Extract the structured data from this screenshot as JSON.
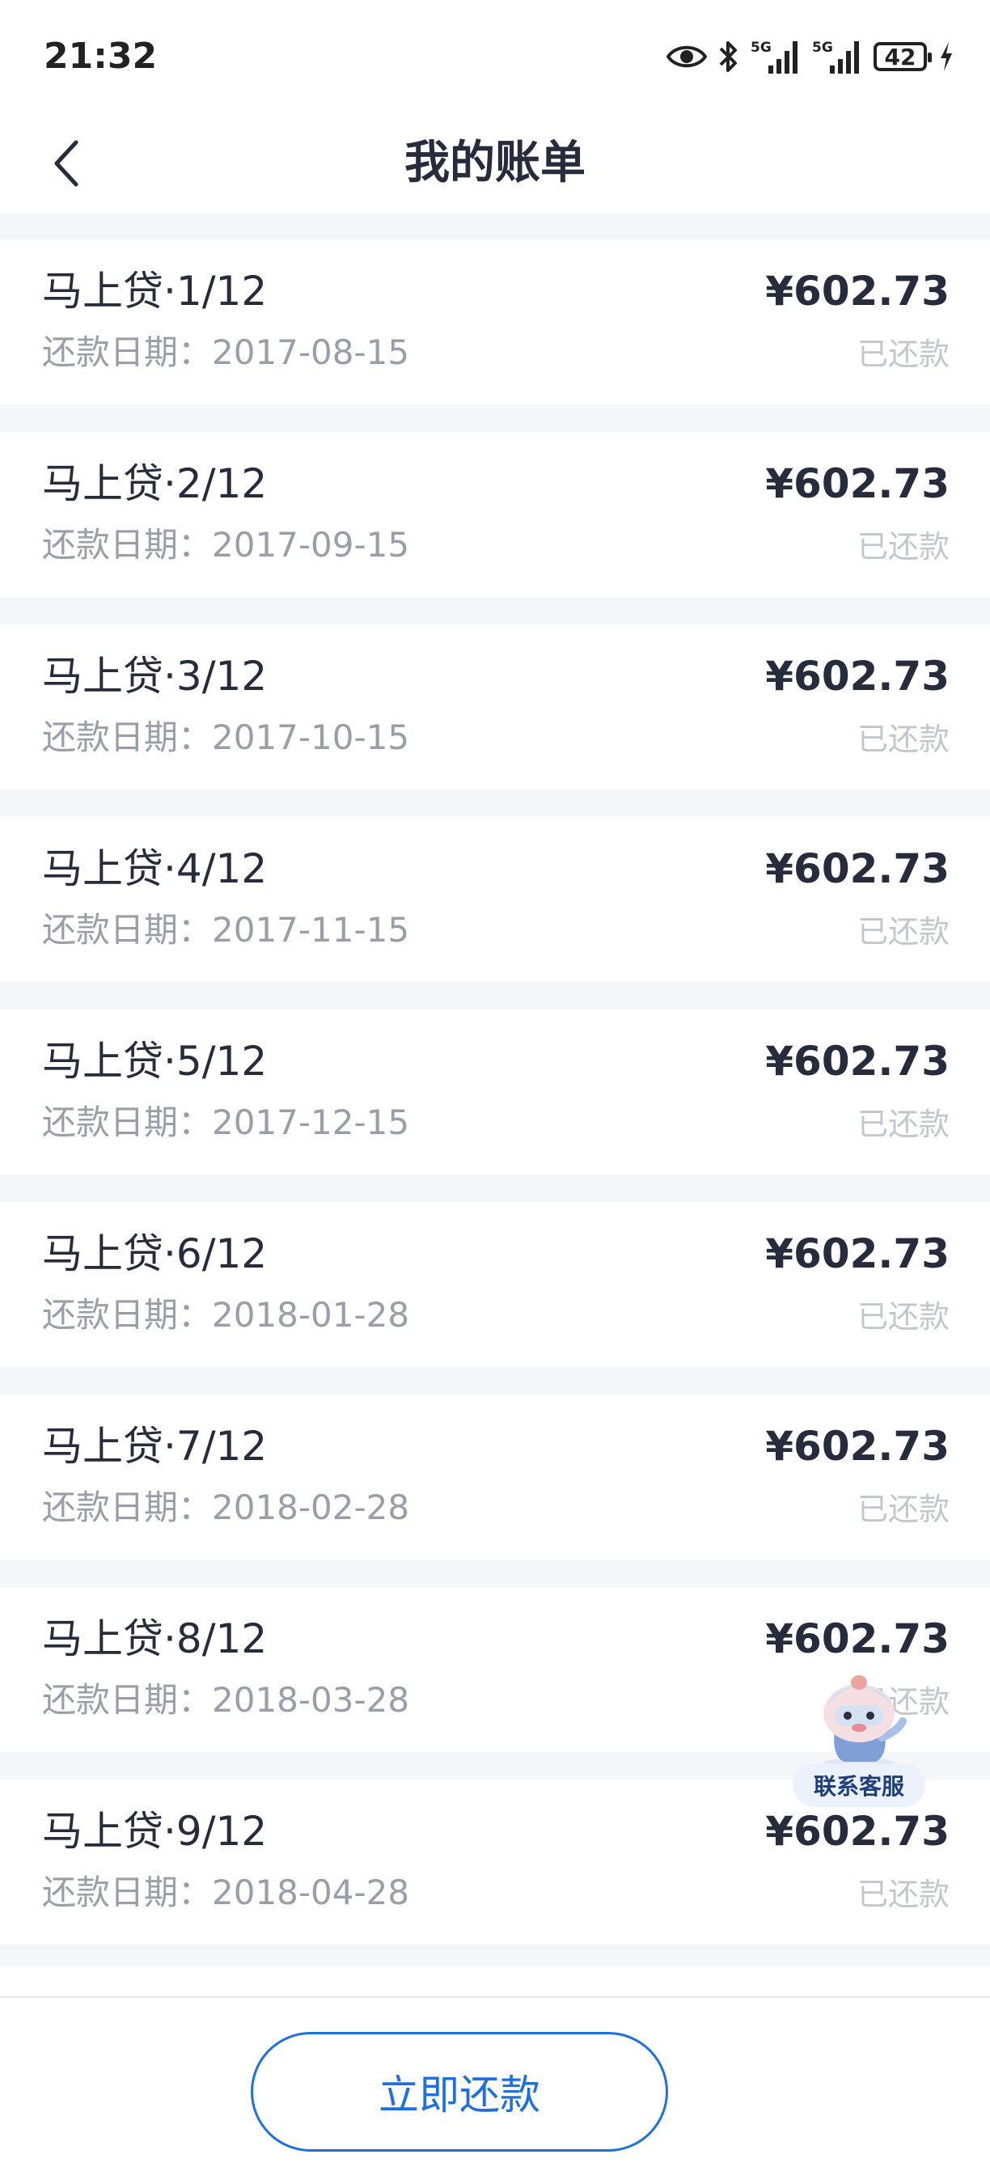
{
  "status_bar": {
    "time": "21:32",
    "battery": "42",
    "icons": [
      "eye-icon",
      "bluetooth-icon",
      "5g-signal-icon",
      "5g-signal-icon",
      "battery-icon",
      "charging-icon"
    ]
  },
  "nav": {
    "title": "我的账单",
    "back_icon": "chevron-left-icon"
  },
  "bills": [
    {
      "title": "马上贷·1/12",
      "date": "还款日期：2017-08-15",
      "amount": "¥602.73",
      "status": "已还款"
    },
    {
      "title": "马上贷·2/12",
      "date": "还款日期：2017-09-15",
      "amount": "¥602.73",
      "status": "已还款"
    },
    {
      "title": "马上贷·3/12",
      "date": "还款日期：2017-10-15",
      "amount": "¥602.73",
      "status": "已还款"
    },
    {
      "title": "马上贷·4/12",
      "date": "还款日期：2017-11-15",
      "amount": "¥602.73",
      "status": "已还款"
    },
    {
      "title": "马上贷·5/12",
      "date": "还款日期：2017-12-15",
      "amount": "¥602.73",
      "status": "已还款"
    },
    {
      "title": "马上贷·6/12",
      "date": "还款日期：2018-01-28",
      "amount": "¥602.73",
      "status": "已还款"
    },
    {
      "title": "马上贷·7/12",
      "date": "还款日期：2018-02-28",
      "amount": "¥602.73",
      "status": "已还款"
    },
    {
      "title": "马上贷·8/12",
      "date": "还款日期：2018-03-28",
      "amount": "¥602.73",
      "status": "已还款"
    },
    {
      "title": "马上贷·9/12",
      "date": "还款日期：2018-04-28",
      "amount": "¥602.73",
      "status": "已还款"
    }
  ],
  "service": {
    "label": "联系客服",
    "icon": "mascot-icon"
  },
  "footer": {
    "repay_label": "立即还款"
  },
  "colors": {
    "accent": "#1f6fdc",
    "text": "#272c3d",
    "muted": "#9a9ea8",
    "status": "#c3c6cd",
    "background": "#f5f6f8"
  }
}
